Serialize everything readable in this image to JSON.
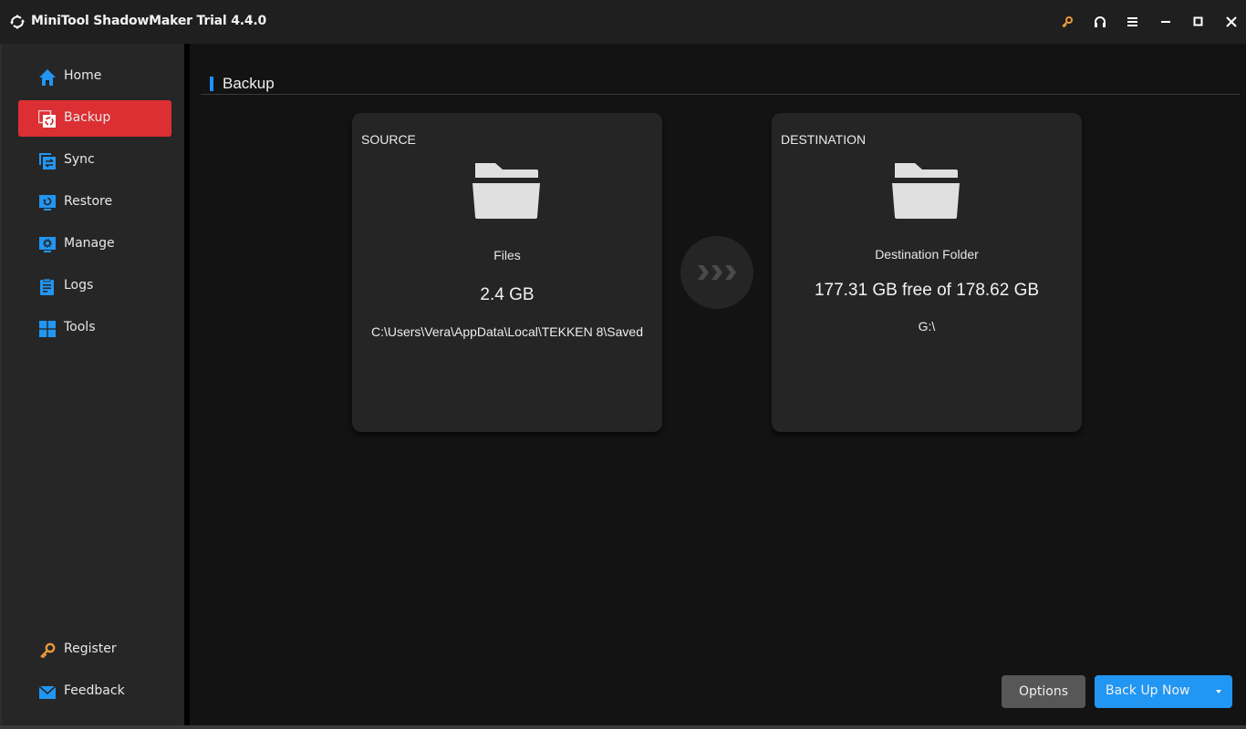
{
  "window": {
    "title": "MiniTool ShadowMaker Trial 4.4.0",
    "controls": [
      {
        "name": "register-key-icon",
        "color": "#e8973a"
      },
      {
        "name": "headset-icon",
        "color": "#ffffff"
      },
      {
        "name": "menu-icon",
        "color": "#ffffff"
      },
      {
        "name": "minimize-icon",
        "color": "#ffffff"
      },
      {
        "name": "maximize-icon",
        "color": "#ffffff"
      },
      {
        "name": "close-icon",
        "color": "#ffffff"
      }
    ]
  },
  "sidebar": {
    "items": [
      {
        "label": "Home",
        "icon": "home-icon",
        "active": false
      },
      {
        "label": "Backup",
        "icon": "backup-icon",
        "active": true
      },
      {
        "label": "Sync",
        "icon": "sync-icon",
        "active": false
      },
      {
        "label": "Restore",
        "icon": "restore-icon",
        "active": false
      },
      {
        "label": "Manage",
        "icon": "manage-icon",
        "active": false
      },
      {
        "label": "Logs",
        "icon": "logs-icon",
        "active": false
      },
      {
        "label": "Tools",
        "icon": "tools-icon",
        "active": false
      }
    ],
    "bottom_items": [
      {
        "label": "Register",
        "icon": "key-icon"
      },
      {
        "label": "Feedback",
        "icon": "mail-icon"
      }
    ]
  },
  "main": {
    "section_title": "Backup",
    "source": {
      "label": "SOURCE",
      "name": "Files",
      "size": "2.4 GB",
      "path": "C:\\Users\\Vera\\AppData\\Local\\TEKKEN 8\\Saved"
    },
    "destination": {
      "label": "DESTINATION",
      "name": "Destination Folder",
      "space": "177.31 GB free of 178.62 GB",
      "path": "G:\\"
    },
    "buttons": {
      "options": "Options",
      "backup_now": "Back Up Now"
    }
  },
  "colors": {
    "accent_blue": "#2196f3",
    "active_red": "#dc2f33",
    "key_orange": "#e8973a"
  }
}
